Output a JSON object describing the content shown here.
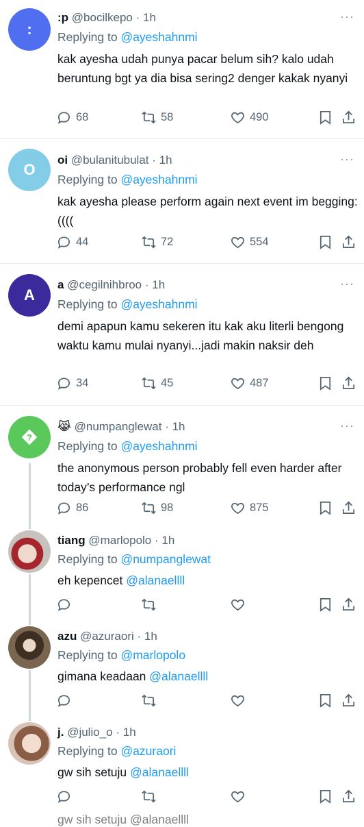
{
  "tweets": [
    {
      "avatar_letter": ":",
      "avatar_color": "#4f6ff0",
      "name": ":p",
      "handle": "@bocilkepo",
      "time": "1h",
      "reply_prefix": "Replying to",
      "reply_to": "@ayeshahnmi",
      "text": "kak ayesha udah punya pacar belum sih? kalo udah beruntung bgt ya dia bisa sering2 denger kakak nyanyi",
      "replies": "68",
      "retweets": "58",
      "likes": "490"
    },
    {
      "avatar_letter": "O",
      "avatar_color": "#83cde9",
      "name": "oi",
      "handle": "@bulanitubulat",
      "time": "1h",
      "reply_prefix": "Replying to",
      "reply_to": "@ayeshahnmi",
      "text": "kak ayesha please perform again next event im begging:((((",
      "replies": "44",
      "retweets": "72",
      "likes": "554"
    },
    {
      "avatar_letter": "A",
      "avatar_color": "#3a2a9c",
      "name": "a",
      "handle": "@cegilnihbroo",
      "time": "1h",
      "reply_prefix": "Replying to",
      "reply_to": "@ayeshahnmi",
      "text": "demi apapun kamu sekeren itu kak aku literli bengong waktu kamu mulai nyanyi...jadi makin naksir deh",
      "replies": "34",
      "retweets": "45",
      "likes": "487"
    },
    {
      "avatar_letter": "?",
      "avatar_color": "#5ac85a",
      "name": "😹",
      "handle": "@numpanglewat",
      "time": "1h",
      "reply_prefix": "Replying to",
      "reply_to": "@ayeshahnmi",
      "text": "the anonymous person probably fell even harder after today’s performance ngl",
      "replies": "86",
      "retweets": "98",
      "likes": "875"
    },
    {
      "avatar_letter": "",
      "avatar_color": "#c9a7a0",
      "name": "tiang",
      "handle": "@marlopolo",
      "time": "1h",
      "reply_prefix": "Replying to",
      "reply_to": "@numpanglewat",
      "text": "eh kepencet",
      "mention": "@alanaellll",
      "replies": "",
      "retweets": "",
      "likes": ""
    },
    {
      "avatar_letter": "",
      "avatar_color": "#6b5a48",
      "name": "azu",
      "handle": "@azuraori",
      "time": "1h",
      "reply_prefix": "Replying to",
      "reply_to": "@marlopolo",
      "text": "gimana keadaan",
      "mention": "@alanaellll",
      "replies": "",
      "retweets": "",
      "likes": ""
    },
    {
      "avatar_letter": "",
      "avatar_color": "#caa48e",
      "name": "j.",
      "handle": "@julio_o",
      "time": "1h",
      "reply_prefix": "Replying to",
      "reply_to": "@azuraori",
      "text": "gw sih setuju",
      "mention": "@alanaellll",
      "replies": "",
      "retweets": "",
      "likes": ""
    }
  ],
  "dot": "·",
  "more_glyph": "···",
  "cut_off_text": "gw sih setuju @alanaellll"
}
